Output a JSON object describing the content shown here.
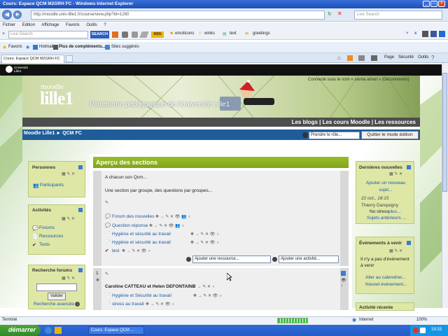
{
  "window": {
    "title": "Cours: Espace QCM M2GRH FC - Windows Internet Explorer",
    "url": "http://moodle.univ-lille1.fr/course/view.php?id=1260",
    "search_placeholder": "Live Search"
  },
  "menu": [
    "Fichier",
    "Edition",
    "Affichage",
    "Favoris",
    "Outils",
    "?"
  ],
  "toolbar": {
    "search_placeholder": "Live Search",
    "search_button": "SEARCH",
    "emoticons": "emoticons",
    "winks": "winks",
    "text": "text",
    "greetings": "greetings"
  },
  "favorites": {
    "label": "Favoris",
    "items": [
      "Hotmail",
      "Plus de compléments...",
      "Sites suggérés"
    ]
  },
  "tab": {
    "label": "Cours: Espace QCM M2GRH FC"
  },
  "ie_tools": [
    "Page",
    "Sécurité",
    "Outils"
  ],
  "moodle": {
    "univ_logo": "Université Lille1",
    "logo_small": "moodle",
    "logo_big": "lille1",
    "tagline": "Plateforme pédagogique de l'Université Lille1",
    "login_text": "Connecté sous le nom « samia amari » (Déconnexion)",
    "topnav": [
      "Les blogs",
      "Les cours Moodle",
      "Les ressources"
    ],
    "breadcrumb": [
      "Moodle Lille1",
      "QCM FC"
    ],
    "role_select": "Prendre le rôle...",
    "quit_edit": "Quitter le mode édition"
  },
  "left": {
    "personnes": {
      "title": "Personnes",
      "items": [
        "Participants"
      ]
    },
    "activites": {
      "title": "Activités",
      "items": [
        "Forums",
        "Ressources",
        "Tests"
      ]
    },
    "recherche": {
      "title": "Recherche forums",
      "button": "Valider",
      "advanced": "Recherche avancée"
    }
  },
  "main": {
    "title": "Aperçu des sections",
    "section0": {
      "summary1": "A chacun son Qcm...",
      "summary2": "Une section par groupe, des questions par groupes...",
      "items": [
        "Forum des nouvelles",
        "Question réponse",
        "Hygiène et sécurité au travail",
        "Hygiène et sécurité au travail",
        "test"
      ],
      "add_resource": "Ajouter une ressource...",
      "add_activity": "Ajouter une activité..."
    },
    "section1": {
      "number": "1",
      "title": "Caroline CATTEAU et Helen DEFONTAINE",
      "items": [
        "Hygiène et Sécurité au travail",
        "stress au travail"
      ]
    }
  },
  "right": {
    "news": {
      "title": "Dernières nouvelles",
      "add": "Ajouter un nouveau sujet...",
      "date": "22 oct., 18:15",
      "author": "Thierry Danquigny",
      "subject": "No stress",
      "more": "plus...",
      "older": "Sujets antérieurs ..."
    },
    "events": {
      "title": "Événements à venir",
      "none": "Il n'y a pas d'événement à venir",
      "calendar": "Aller au calendrier...",
      "new": "Nouvel événement..."
    },
    "recent": {
      "title": "Activité récente"
    }
  },
  "status": {
    "left": "Terminé",
    "zone": "Internet",
    "zoom": "100%"
  },
  "taskbar": {
    "start": "démarrer",
    "item": "Cours: Espace QCM ...",
    "clock": "19:33"
  }
}
